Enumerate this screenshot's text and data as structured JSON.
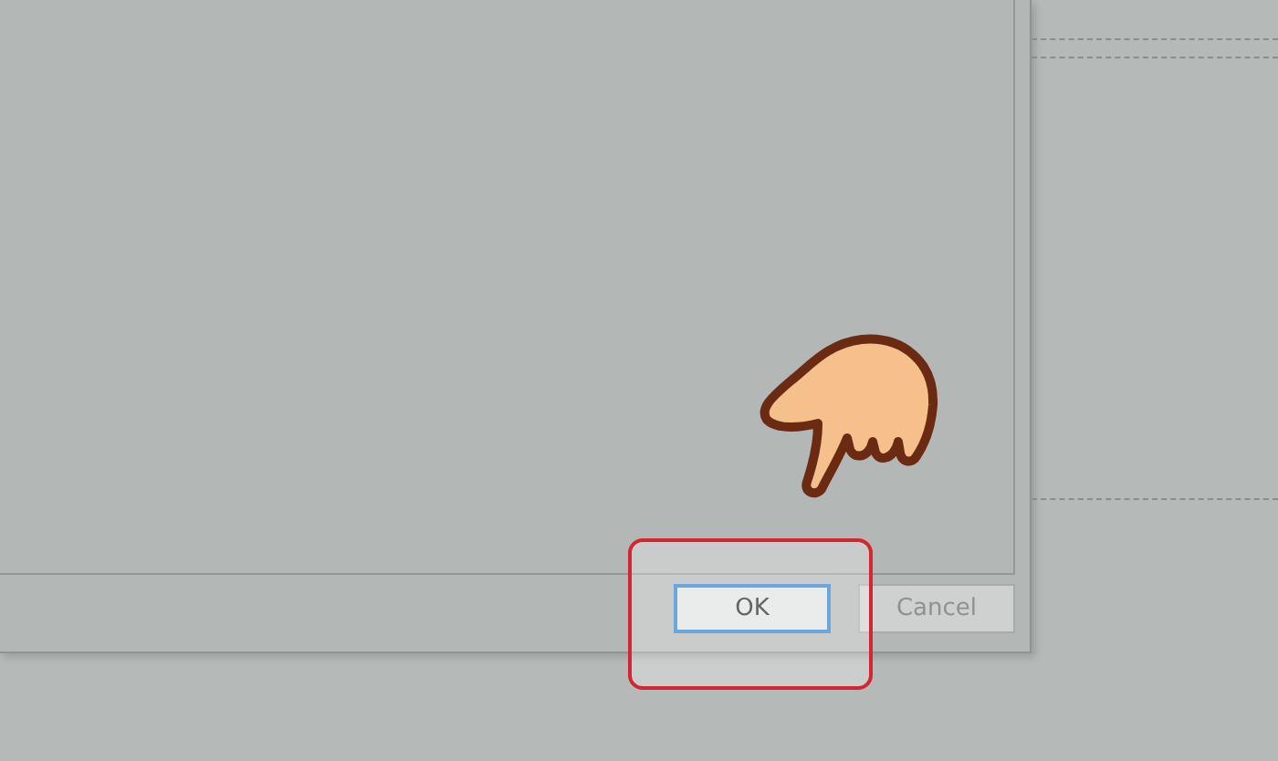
{
  "dialog": {
    "buttons": [
      {
        "label": "OK",
        "default": true,
        "disabled": false
      },
      {
        "label": "Cancel",
        "default": false,
        "disabled": true
      }
    ]
  }
}
